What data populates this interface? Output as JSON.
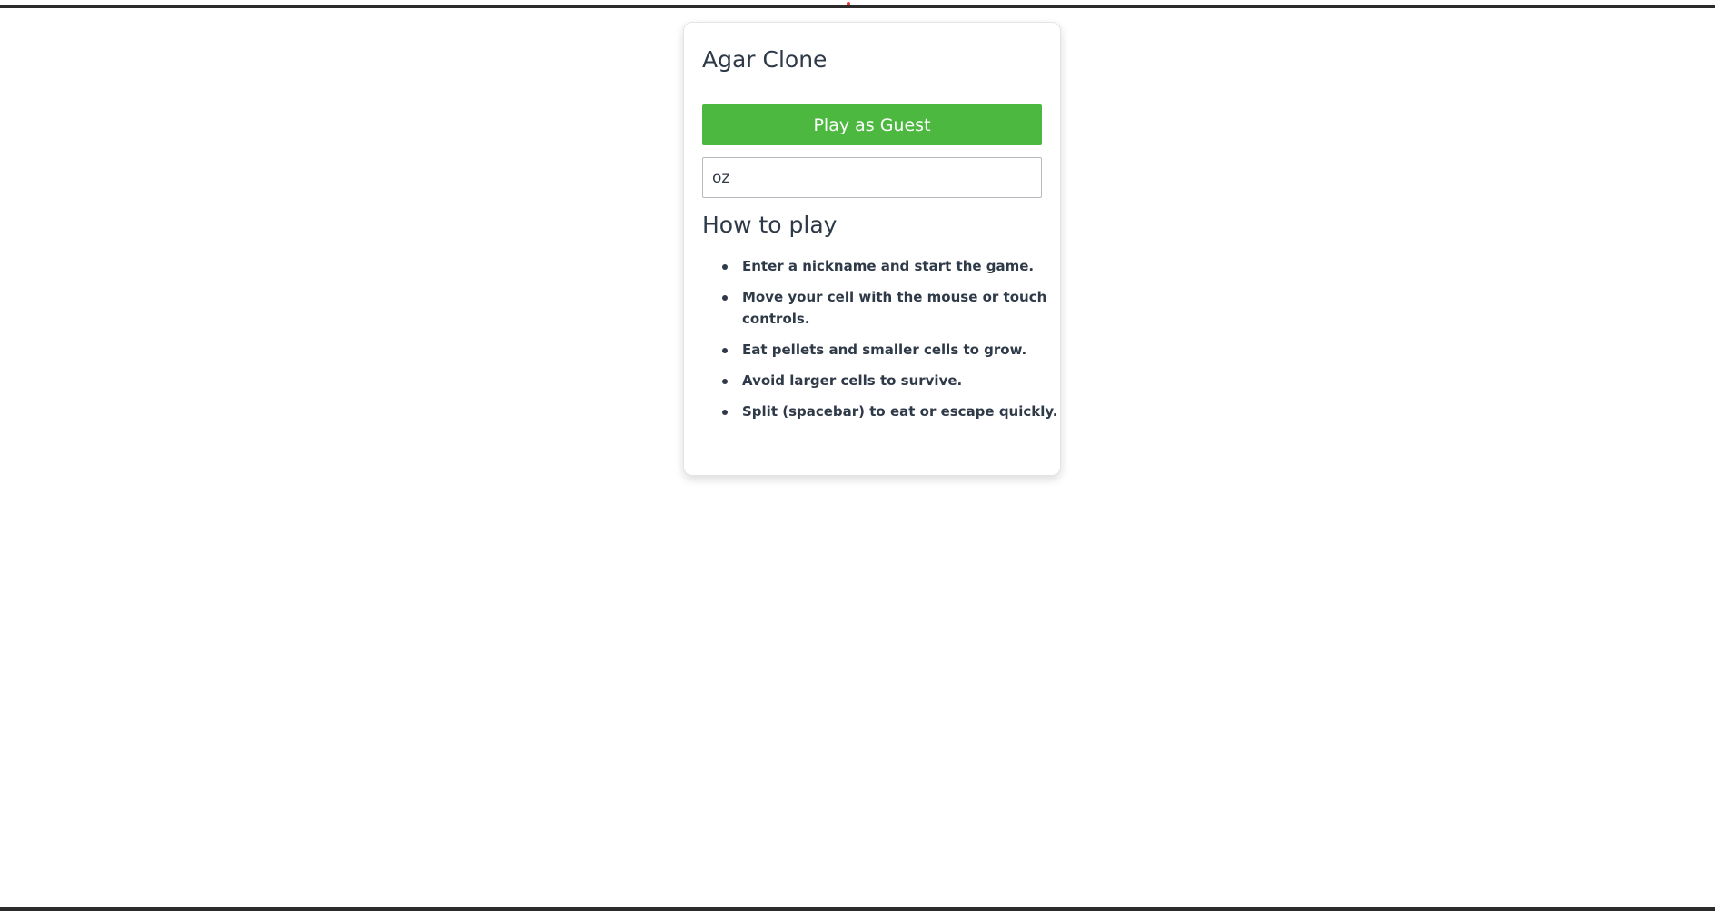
{
  "app": {
    "title": "Agar Clone"
  },
  "menu": {
    "play_label": "Play as Guest",
    "nickname_value": "oz"
  },
  "howto": {
    "heading": "How to play",
    "items": [
      "Enter a nickname and start the game.",
      "Move your cell with the mouse or touch controls.",
      "Eat pellets and smaller cells to grow.",
      "Avoid larger cells to survive.",
      "Split (spacebar) to eat or escape quickly."
    ]
  },
  "colors": {
    "play_button": "#4cb83f",
    "text": "#2f3a48"
  }
}
